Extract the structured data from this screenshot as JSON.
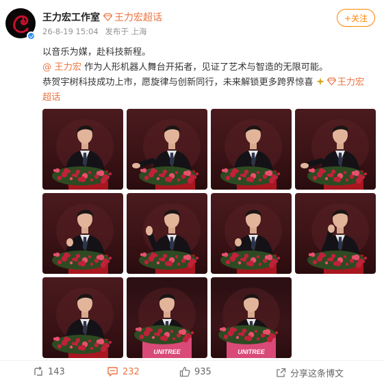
{
  "post": {
    "author": "王力宏工作室",
    "super_topic": "王力宏超话",
    "timestamp": "26-8-19 15:04",
    "source": "发布于 上海",
    "follow_label": "+关注",
    "lines": {
      "line1": "以音乐为媒，赴科技新程。",
      "mention": "@ 王力宏",
      "line2_rest": " 作为人形机器人舞台开拓者，见证了艺术与智造的无限可能。",
      "line3": "恭贺宇树科技成功上市，愿旋律与创新同行，未来解锁更多跨界惊喜",
      "topic_part1": "王力宏",
      "topic_part2": "超话"
    }
  },
  "photos": [
    {
      "index": 1,
      "gesture": "standing"
    },
    {
      "index": 2,
      "gesture": "hand-out"
    },
    {
      "index": 3,
      "gesture": "standing"
    },
    {
      "index": 4,
      "gesture": "hand-out"
    },
    {
      "index": 5,
      "gesture": "thumb"
    },
    {
      "index": 6,
      "gesture": "wave"
    },
    {
      "index": 7,
      "gesture": "point"
    },
    {
      "index": 8,
      "gesture": "phone"
    },
    {
      "index": 9,
      "gesture": "standing"
    },
    {
      "index": 10,
      "gesture": "standing",
      "podium_text": "UNITREE"
    },
    {
      "index": 11,
      "gesture": "standing",
      "podium_text": "UNITREE"
    }
  ],
  "footer": {
    "reposts": "143",
    "comments": "232",
    "likes": "935",
    "share_label": "分享这条博文"
  },
  "colors": {
    "accent": "#eb7340",
    "follow": "#ff8200",
    "verified": "#2f8ef0"
  },
  "icons": [
    "avatar-dragon-logo",
    "verified-icon",
    "diamond-icon",
    "repost-icon",
    "comment-icon",
    "like-icon",
    "share-icon",
    "sparkle-icon"
  ]
}
